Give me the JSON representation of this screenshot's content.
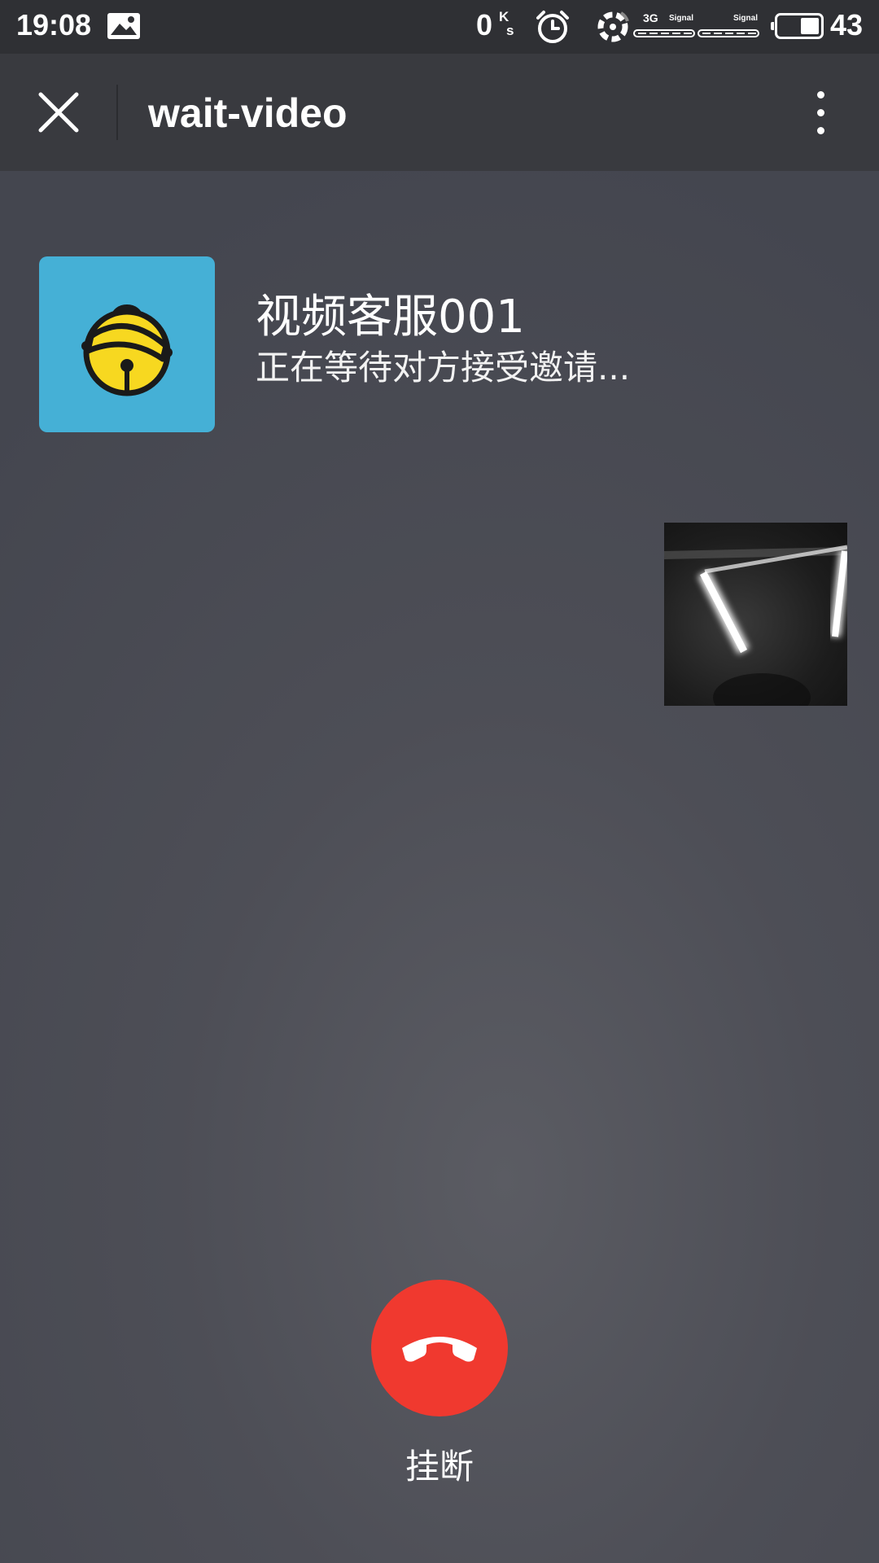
{
  "status_bar": {
    "time": "19:08",
    "net_speed_value": "0",
    "net_speed_unit_top": "K",
    "net_speed_unit_bottom": "s",
    "network_type": "3G",
    "signal_label_1": "Signal",
    "signal_label_2": "Signal",
    "battery_level": "43",
    "icons": [
      "gallery-icon",
      "alarm-icon",
      "wifi-icon",
      "signal-icon",
      "battery-icon"
    ]
  },
  "title_bar": {
    "title": "wait-video",
    "close_icon": "close-icon",
    "more_icon": "more-vertical-icon"
  },
  "caller": {
    "name": "视频客服001",
    "status": "正在等待对方接受邀请...",
    "avatar_icon": "bell-icon"
  },
  "controls": {
    "hangup_label": "挂断",
    "hangup_icon": "phone-hangup-icon"
  },
  "colors": {
    "hangup": "#f0392f",
    "avatar_bg": "#45b0d6",
    "title_bar": "#393a3f",
    "status_bar": "#2f3034"
  }
}
